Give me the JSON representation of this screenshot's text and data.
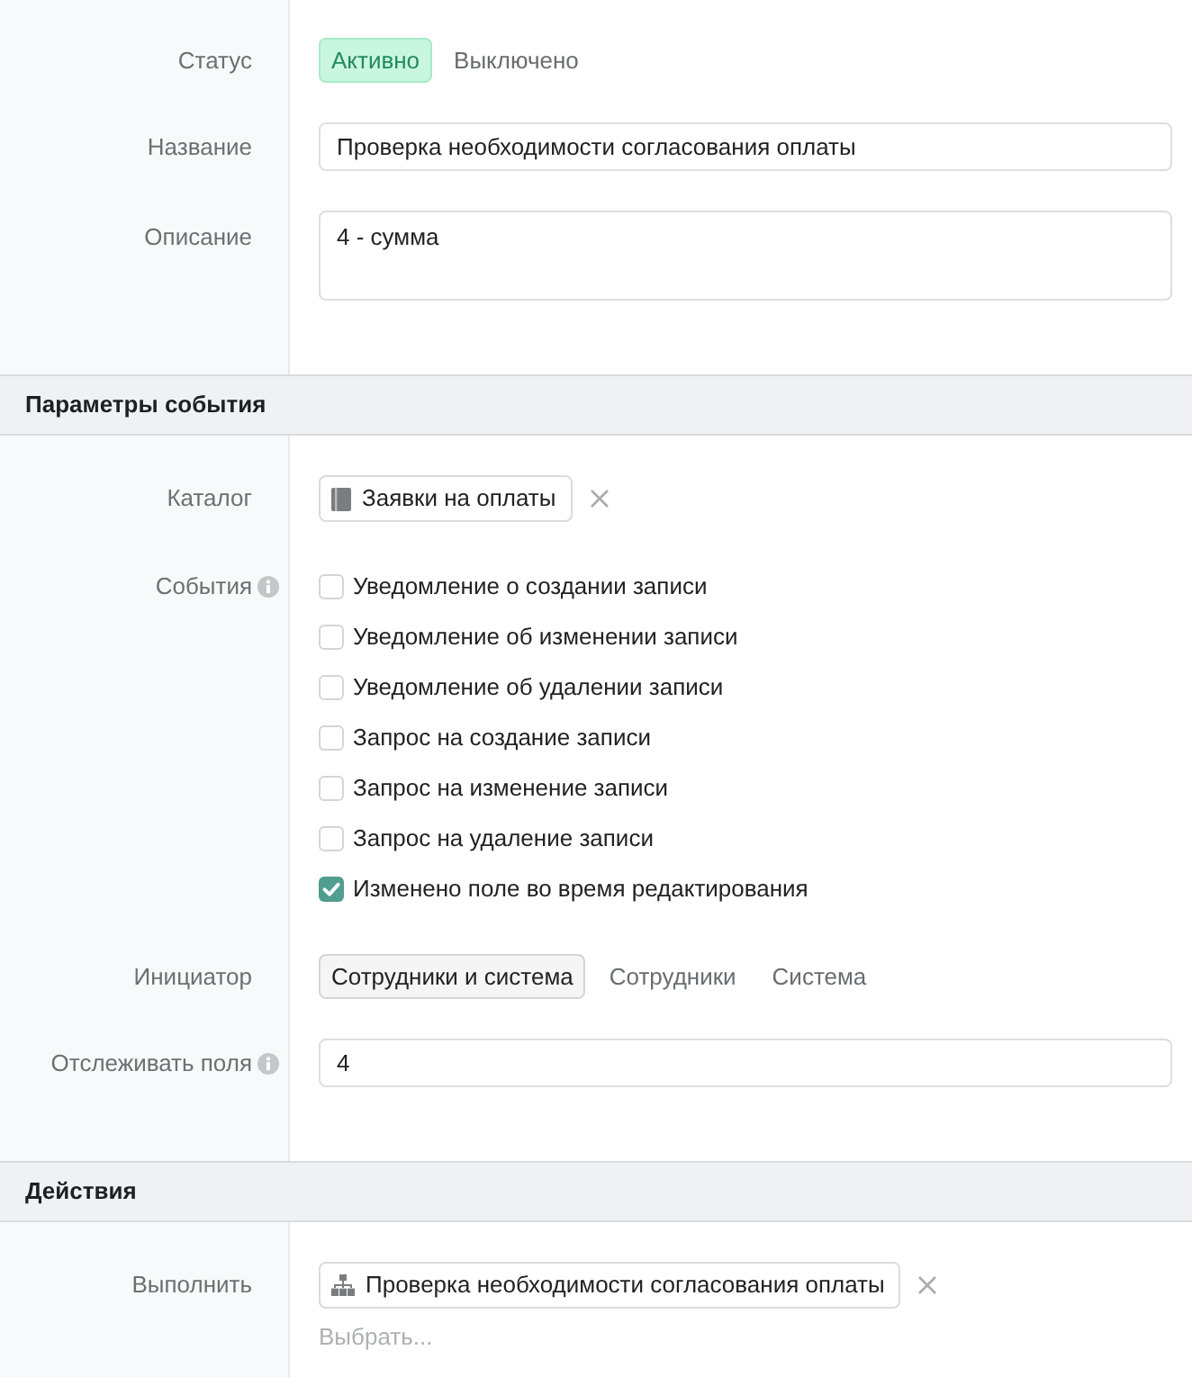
{
  "sections": [
    {
      "fields": [
        {
          "kind": "status",
          "label": "Статус",
          "info": false,
          "options": [
            {
              "label": "Активно",
              "selected": true
            },
            {
              "label": "Выключено",
              "selected": false
            }
          ]
        },
        {
          "kind": "text",
          "label": "Название",
          "info": false,
          "value": "Проверка необходимости согласования оплаты"
        },
        {
          "kind": "textarea",
          "label": "Описание",
          "info": false,
          "value": "4 - сумма"
        }
      ]
    },
    {
      "title": "Параметры события",
      "fields": [
        {
          "kind": "catalog",
          "label": "Каталог",
          "info": false,
          "items": [
            {
              "label": "Заявки на оплаты"
            }
          ]
        },
        {
          "kind": "checklist",
          "label": "События",
          "info": true,
          "options": [
            {
              "label": "Уведомление о создании записи",
              "checked": false
            },
            {
              "label": "Уведомление об изменении записи",
              "checked": false
            },
            {
              "label": "Уведомление об удалении записи",
              "checked": false
            },
            {
              "label": "Запрос на создание записи",
              "checked": false
            },
            {
              "label": "Запрос на изменение записи",
              "checked": false
            },
            {
              "label": "Запрос на удаление записи",
              "checked": false
            },
            {
              "label": "Изменено поле во время редактирования",
              "checked": true
            }
          ]
        },
        {
          "kind": "choice",
          "label": "Инициатор",
          "info": false,
          "options": [
            {
              "label": "Сотрудники и система",
              "selected": true
            },
            {
              "label": "Сотрудники",
              "selected": false
            },
            {
              "label": "Система",
              "selected": false
            }
          ]
        },
        {
          "kind": "text",
          "label": "Отслеживать поля",
          "info": true,
          "value": "4"
        }
      ]
    },
    {
      "title": "Действия",
      "fields": [
        {
          "kind": "actions",
          "label": "Выполнить",
          "info": false,
          "items": [
            {
              "label": "Проверка необходимости согласования оплаты"
            }
          ],
          "placeholder": "Выбрать..."
        }
      ]
    }
  ]
}
